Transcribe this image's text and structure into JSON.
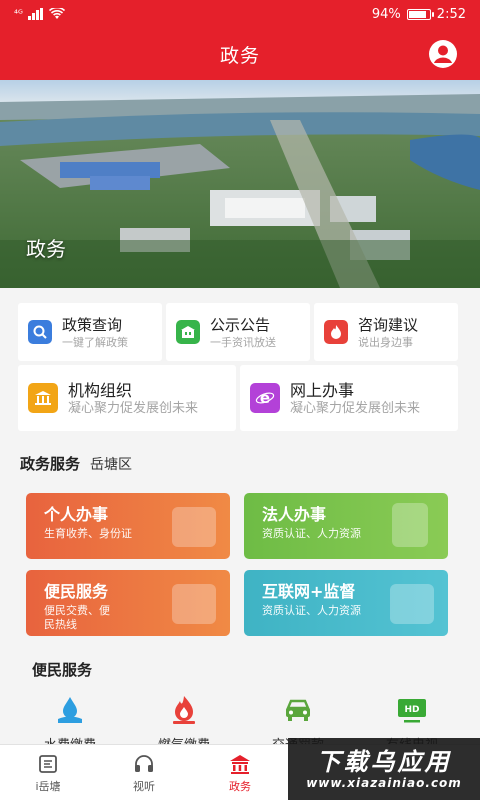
{
  "status_bar": {
    "carrier": "⁴ᴳ",
    "battery": "94%",
    "battery_level": 0.94,
    "time": "2:52"
  },
  "header": {
    "title": "政务"
  },
  "banner": {
    "label": "政务"
  },
  "quick_links": [
    {
      "title": "政策查询",
      "subtitle": "一键了解政策",
      "icon": "search-icon",
      "color": "#3b7ddd"
    },
    {
      "title": "公示公告",
      "subtitle": "一手资讯放送",
      "icon": "notice-icon",
      "color": "#37b44a"
    },
    {
      "title": "咨询建议",
      "subtitle": "说出身边事",
      "icon": "flame-icon",
      "color": "#e8413a"
    },
    {
      "title": "机构组织",
      "subtitle": "凝心聚力促发展创未来",
      "icon": "institution-icon",
      "color": "#f2a516"
    },
    {
      "title": "网上办事",
      "subtitle": "凝心聚力促发展创未来",
      "icon": "ie-icon",
      "color": "#b341d8"
    }
  ],
  "gov_services": {
    "heading": "政务服务",
    "district": "岳塘区",
    "cards": [
      {
        "title": "个人办事",
        "subtitle": "生育收养、身份证",
        "color": "#e8633e"
      },
      {
        "title": "法人办事",
        "subtitle": "资质认证、人力资源",
        "color": "#74c04a"
      },
      {
        "title": "便民服务",
        "subtitle": "便民交费、便民热线",
        "color": "#ea6a3e"
      },
      {
        "title": "互联网+监督",
        "subtitle": "资质认证、人力资源",
        "color": "#3fb3c4"
      }
    ]
  },
  "convenience": {
    "heading": "便民服务",
    "items": [
      {
        "label": "水费缴费",
        "icon": "water-drop-icon",
        "color": "#2d9ee0"
      },
      {
        "label": "燃气缴费",
        "icon": "gas-flame-icon",
        "color": "#e8413a"
      },
      {
        "label": "交通罚款",
        "icon": "car-icon",
        "color": "#5aa63c"
      },
      {
        "label": "有线电视",
        "icon": "tv-hd-icon",
        "color": "#39a935"
      }
    ]
  },
  "tabs": [
    {
      "label": "i岳塘",
      "icon": "home-tab-icon"
    },
    {
      "label": "视听",
      "icon": "headphones-icon"
    },
    {
      "label": "政务",
      "icon": "government-icon",
      "active": true
    },
    {
      "label": "",
      "icon": ""
    },
    {
      "label": "",
      "icon": ""
    }
  ],
  "watermark": {
    "text": "下载乌应用",
    "url": "www.xiazainiao.com"
  },
  "colors": {
    "primary": "#e5202b"
  }
}
